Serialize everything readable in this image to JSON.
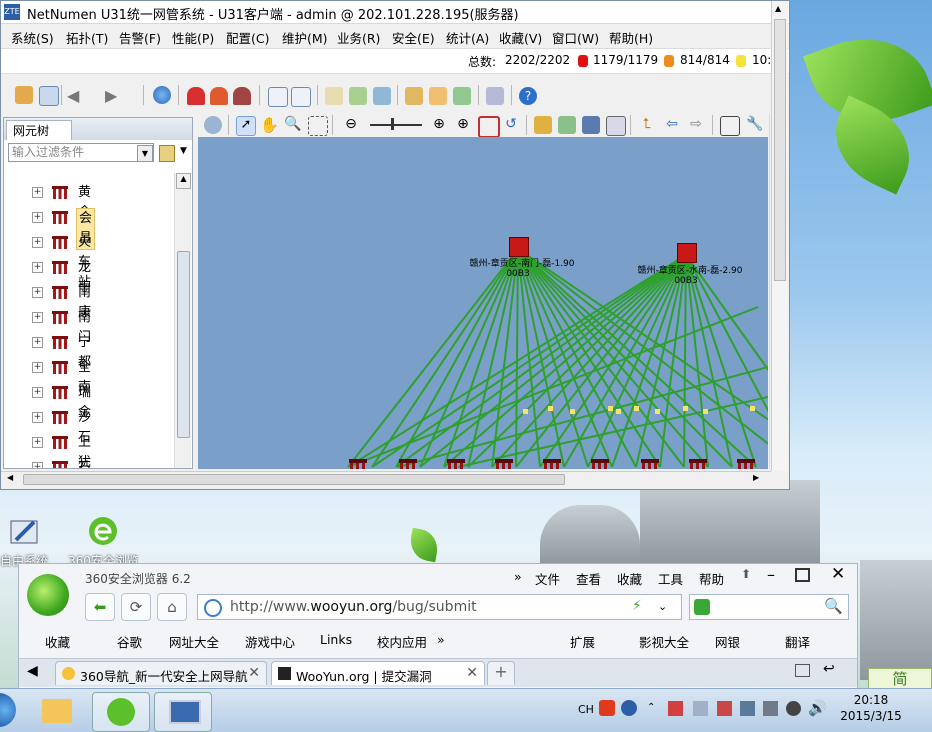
{
  "desktop": {
    "icons": [
      {
        "label": "自由系统",
        "icon": "app-icon"
      },
      {
        "label": "360安全浏览",
        "icon": "browser-icon"
      }
    ],
    "right_badge": "简"
  },
  "netnumen": {
    "title": "NetNumen U31统一网管系统 - U31客户端 - admin @ 202.101.228.195(服务器)",
    "menu": [
      "系统(S)",
      "拓扑(T)",
      "告警(F)",
      "性能(P)",
      "配置(C)",
      "维护(M)",
      "业务(R)",
      "安全(E)",
      "统计(A)",
      "收藏(V)",
      "窗口(W)",
      "帮助(H)"
    ],
    "status": {
      "total_label": "总数:",
      "total": "2202/2202",
      "critical": "1179/1179",
      "major": "814/814",
      "minor": "10:",
      "colors": {
        "critical": "#e01010",
        "major": "#f08a1c",
        "minor": "#f2e43a"
      }
    },
    "tree": {
      "tab_label": "网元树",
      "filter_placeholder": "输入过滤条件",
      "items": [
        "黄金",
        "会昌",
        "火车站",
        "龙南",
        "南康",
        "南门",
        "宁都",
        "全南",
        "瑞金",
        "沙石",
        "上犹",
        "石城"
      ],
      "selected": "会昌"
    },
    "topology": {
      "nodes": [
        {
          "label": "赣州-章贡区-南门-磊-1.90",
          "sub": "00B3"
        },
        {
          "label": "赣州-章贡区-水南-磊-2.90",
          "sub": "00B3"
        }
      ],
      "background": "#7a9fc8",
      "link_color": "#2ea02e"
    }
  },
  "browser": {
    "title": "360安全浏览器 6.2",
    "menu": [
      "文件",
      "查看",
      "收藏",
      "工具",
      "帮助"
    ],
    "address": {
      "prefix": "http://www.",
      "domain": "wooyun.org",
      "path": "/bug/submit"
    },
    "favorites": [
      "收藏",
      "谷歌",
      "网址大全",
      "游戏中心",
      "Links",
      "校内应用"
    ],
    "right_tools": [
      "扩展",
      "影视大全",
      "网银",
      "翻译"
    ],
    "tabs": [
      {
        "title": "360导航_新一代安全上网导航",
        "active": false
      },
      {
        "title": "WooYun.org | 提交漏洞",
        "active": true
      }
    ]
  },
  "taskbar": {
    "tray": {
      "lang": "CH"
    },
    "time": "20:18",
    "date": "2015/3/15"
  }
}
